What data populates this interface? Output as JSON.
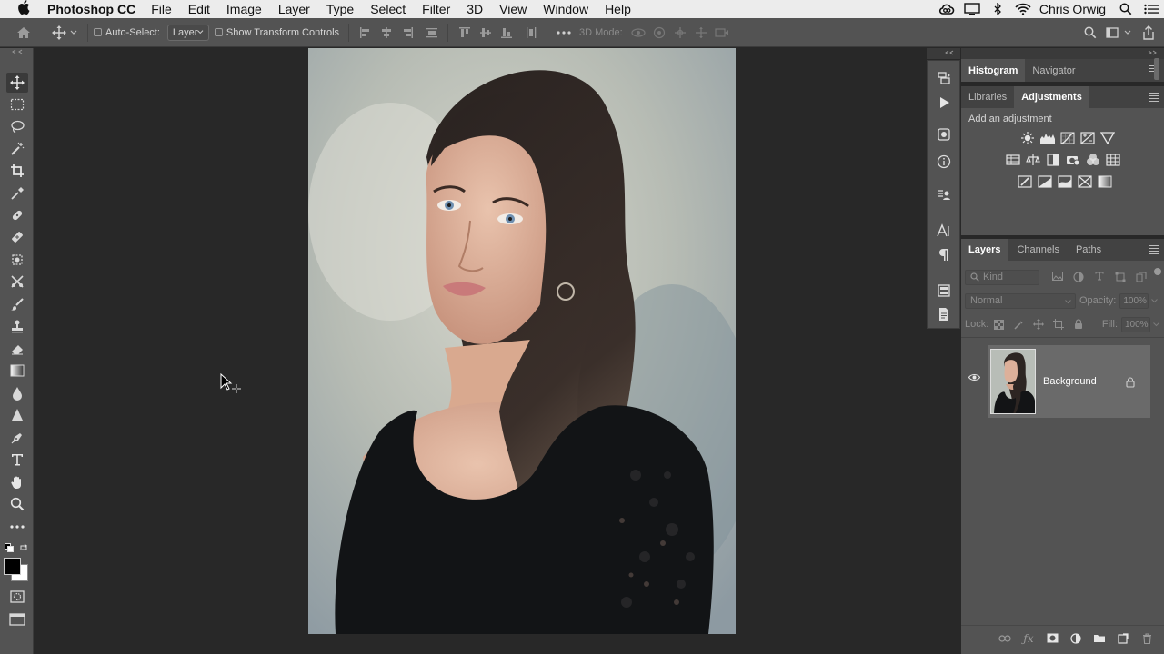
{
  "menubar": {
    "app_name": "Photoshop CC",
    "menus": [
      "File",
      "Edit",
      "Image",
      "Layer",
      "Type",
      "Select",
      "Filter",
      "3D",
      "View",
      "Window",
      "Help"
    ],
    "user_name": "Chris Orwig"
  },
  "options_bar": {
    "auto_select_label": "Auto-Select:",
    "auto_select_value": "Layer",
    "show_transform_label": "Show Transform Controls",
    "mode_3d_label": "3D Mode:"
  },
  "panels": {
    "top_tabs": [
      "Histogram",
      "Navigator"
    ],
    "mid_tabs": [
      "Libraries",
      "Adjustments"
    ],
    "adjustments_heading": "Add an adjustment",
    "layers_tabs": [
      "Layers",
      "Channels",
      "Paths"
    ],
    "kind_placeholder": "Kind",
    "blend_mode": "Normal",
    "opacity_label": "Opacity:",
    "opacity_value": "100%",
    "lock_label": "Lock:",
    "fill_label": "Fill:",
    "fill_value": "100%",
    "layer_name": "Background"
  },
  "colors": {
    "accent_foreground": "#000000",
    "accent_background": "#ffffff"
  }
}
